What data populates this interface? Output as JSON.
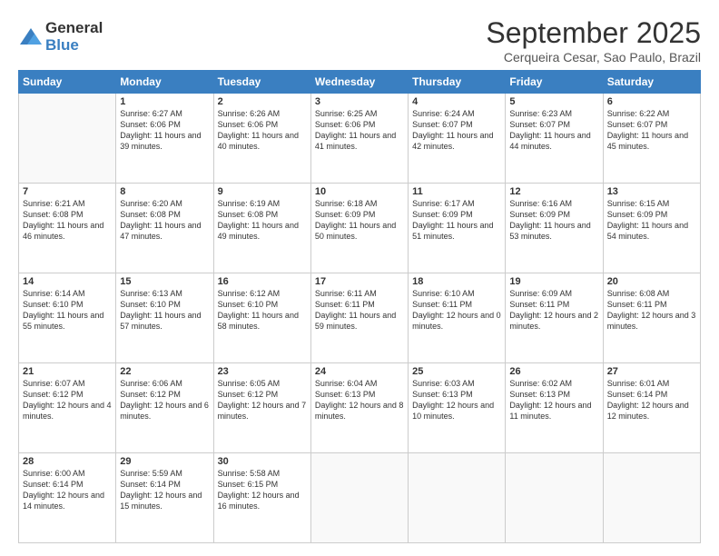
{
  "logo": {
    "general": "General",
    "blue": "Blue"
  },
  "header": {
    "month": "September 2025",
    "location": "Cerqueira Cesar, Sao Paulo, Brazil"
  },
  "days_header": [
    "Sunday",
    "Monday",
    "Tuesday",
    "Wednesday",
    "Thursday",
    "Friday",
    "Saturday"
  ],
  "weeks": [
    [
      {
        "num": "",
        "empty": true
      },
      {
        "num": "1",
        "sunrise": "6:27 AM",
        "sunset": "6:06 PM",
        "daylight": "11 hours and 39 minutes."
      },
      {
        "num": "2",
        "sunrise": "6:26 AM",
        "sunset": "6:06 PM",
        "daylight": "11 hours and 40 minutes."
      },
      {
        "num": "3",
        "sunrise": "6:25 AM",
        "sunset": "6:06 PM",
        "daylight": "11 hours and 41 minutes."
      },
      {
        "num": "4",
        "sunrise": "6:24 AM",
        "sunset": "6:07 PM",
        "daylight": "11 hours and 42 minutes."
      },
      {
        "num": "5",
        "sunrise": "6:23 AM",
        "sunset": "6:07 PM",
        "daylight": "11 hours and 44 minutes."
      },
      {
        "num": "6",
        "sunrise": "6:22 AM",
        "sunset": "6:07 PM",
        "daylight": "11 hours and 45 minutes."
      }
    ],
    [
      {
        "num": "7",
        "sunrise": "6:21 AM",
        "sunset": "6:08 PM",
        "daylight": "11 hours and 46 minutes."
      },
      {
        "num": "8",
        "sunrise": "6:20 AM",
        "sunset": "6:08 PM",
        "daylight": "11 hours and 47 minutes."
      },
      {
        "num": "9",
        "sunrise": "6:19 AM",
        "sunset": "6:08 PM",
        "daylight": "11 hours and 49 minutes."
      },
      {
        "num": "10",
        "sunrise": "6:18 AM",
        "sunset": "6:09 PM",
        "daylight": "11 hours and 50 minutes."
      },
      {
        "num": "11",
        "sunrise": "6:17 AM",
        "sunset": "6:09 PM",
        "daylight": "11 hours and 51 minutes."
      },
      {
        "num": "12",
        "sunrise": "6:16 AM",
        "sunset": "6:09 PM",
        "daylight": "11 hours and 53 minutes."
      },
      {
        "num": "13",
        "sunrise": "6:15 AM",
        "sunset": "6:09 PM",
        "daylight": "11 hours and 54 minutes."
      }
    ],
    [
      {
        "num": "14",
        "sunrise": "6:14 AM",
        "sunset": "6:10 PM",
        "daylight": "11 hours and 55 minutes."
      },
      {
        "num": "15",
        "sunrise": "6:13 AM",
        "sunset": "6:10 PM",
        "daylight": "11 hours and 57 minutes."
      },
      {
        "num": "16",
        "sunrise": "6:12 AM",
        "sunset": "6:10 PM",
        "daylight": "11 hours and 58 minutes."
      },
      {
        "num": "17",
        "sunrise": "6:11 AM",
        "sunset": "6:11 PM",
        "daylight": "11 hours and 59 minutes."
      },
      {
        "num": "18",
        "sunrise": "6:10 AM",
        "sunset": "6:11 PM",
        "daylight": "12 hours and 0 minutes."
      },
      {
        "num": "19",
        "sunrise": "6:09 AM",
        "sunset": "6:11 PM",
        "daylight": "12 hours and 2 minutes."
      },
      {
        "num": "20",
        "sunrise": "6:08 AM",
        "sunset": "6:11 PM",
        "daylight": "12 hours and 3 minutes."
      }
    ],
    [
      {
        "num": "21",
        "sunrise": "6:07 AM",
        "sunset": "6:12 PM",
        "daylight": "12 hours and 4 minutes."
      },
      {
        "num": "22",
        "sunrise": "6:06 AM",
        "sunset": "6:12 PM",
        "daylight": "12 hours and 6 minutes."
      },
      {
        "num": "23",
        "sunrise": "6:05 AM",
        "sunset": "6:12 PM",
        "daylight": "12 hours and 7 minutes."
      },
      {
        "num": "24",
        "sunrise": "6:04 AM",
        "sunset": "6:13 PM",
        "daylight": "12 hours and 8 minutes."
      },
      {
        "num": "25",
        "sunrise": "6:03 AM",
        "sunset": "6:13 PM",
        "daylight": "12 hours and 10 minutes."
      },
      {
        "num": "26",
        "sunrise": "6:02 AM",
        "sunset": "6:13 PM",
        "daylight": "12 hours and 11 minutes."
      },
      {
        "num": "27",
        "sunrise": "6:01 AM",
        "sunset": "6:14 PM",
        "daylight": "12 hours and 12 minutes."
      }
    ],
    [
      {
        "num": "28",
        "sunrise": "6:00 AM",
        "sunset": "6:14 PM",
        "daylight": "12 hours and 14 minutes."
      },
      {
        "num": "29",
        "sunrise": "5:59 AM",
        "sunset": "6:14 PM",
        "daylight": "12 hours and 15 minutes."
      },
      {
        "num": "30",
        "sunrise": "5:58 AM",
        "sunset": "6:15 PM",
        "daylight": "12 hours and 16 minutes."
      },
      {
        "num": "",
        "empty": true
      },
      {
        "num": "",
        "empty": true
      },
      {
        "num": "",
        "empty": true
      },
      {
        "num": "",
        "empty": true
      }
    ]
  ]
}
